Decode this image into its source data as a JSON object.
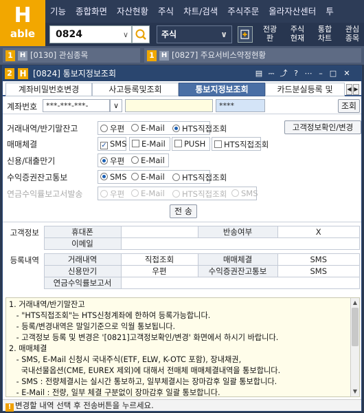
{
  "app": {
    "logo_letter": "H",
    "logo_word": "able"
  },
  "topmenu": [
    "기능",
    "종합화면",
    "자산현황",
    "주식",
    "차트/검색",
    "주식주문",
    "올라자산센터",
    "투"
  ],
  "toolbar": {
    "code": "0824",
    "market": "주식",
    "buttons": [
      [
        "전광",
        "판"
      ],
      [
        "주식",
        "현재"
      ],
      [
        "통합",
        "차트"
      ],
      [
        "관심",
        "종목"
      ]
    ]
  },
  "window_tabs": [
    {
      "num": "1",
      "label": "[0130] 관심종목"
    },
    {
      "num": "1",
      "label": "[0827] 주요서비스약정현황"
    }
  ],
  "window": {
    "num": "2",
    "title": "[0824] 통보지정보조회",
    "subtabs": [
      "계좌비밀번호변경",
      "사고등록및조회",
      "통보지정보조회",
      "카드분실등록 및"
    ],
    "active_tab": 2
  },
  "account": {
    "label": "계좌번호",
    "number": "***-***-***-",
    "password": "****",
    "inquiry_button": "조회"
  },
  "options": {
    "customer_info_button": "고객정보확인/변경",
    "rows": [
      {
        "label": "거래내역/반기말잔고",
        "choices": [
          "우편",
          "E-Mail",
          "HTS직접조회"
        ],
        "type": "radio",
        "selected": [
          2
        ],
        "disabled": false
      },
      {
        "label": "매매체결",
        "choices": [
          "SMS",
          "E-Mail",
          "PUSH",
          "HTS직접조회"
        ],
        "type": "check",
        "selected": [
          0
        ],
        "disabled": false
      },
      {
        "label": "신용/대출만기",
        "choices": [
          "우편",
          "E-Mail"
        ],
        "type": "radio",
        "selected": [
          0
        ],
        "disabled": false
      },
      {
        "label": "수익증권잔고통보",
        "choices": [
          "SMS",
          "E-Mail",
          "HTS직접조회"
        ],
        "type": "radio",
        "selected": [
          0
        ],
        "disabled": false
      },
      {
        "label": "연금수익률보고서발송",
        "choices": [
          "우편",
          "E-Mail",
          "HTS직접조회",
          "SMS"
        ],
        "type": "radio",
        "selected": [],
        "disabled": true
      }
    ],
    "send_button": "전 송"
  },
  "customer_info": {
    "section": "고객정보",
    "phone_label": "휴대폰",
    "phone_value": "",
    "bounce_label": "반송여부",
    "bounce_value": "X",
    "email_label": "이메일",
    "email_value": ""
  },
  "registration": {
    "section": "등록내역",
    "trade_history_label": "거래내역",
    "trade_history_value": "직접조회",
    "execution_label": "매매체결",
    "execution_value": "SMS",
    "credit_label": "신용만기",
    "credit_value": "우편",
    "fund_label": "수익증권잔고통보",
    "fund_value": "SMS",
    "pension_label": "연금수익률보고서",
    "pension_value": ""
  },
  "notes": [
    "1. 거래내역/반기말잔고",
    "   - \"HTS직접조회\"는 HTS신청계좌에 한하여 등록가능합니다.",
    "   - 등록/변경내역은 말일기준으로 익월 통보됩니다.",
    "   - 고객정보 등록 및 변경은 '[0821]고객정보확인/변경' 화면에서 하시기 바랍니다.",
    "2. 매매체결",
    "   - SMS, E-Mail 신청시 국내주식(ETF, ELW, K-OTC 포함), 장내채권,",
    "     국내선물옵션(CME, EUREX 제외)에 대해서 전매체 매매체결내역을 통보합니다.",
    "   - SMS : 전량체결시는 실시간 통보하고, 일부체결시는 장마감후 일괄 통보합니다.",
    "   - E-Mail : 전량, 일부 체결 구분없이 장마감후 일괄 통보합니다."
  ],
  "status": "변경할 내역 선택 후 전송버튼을 누르세요."
}
